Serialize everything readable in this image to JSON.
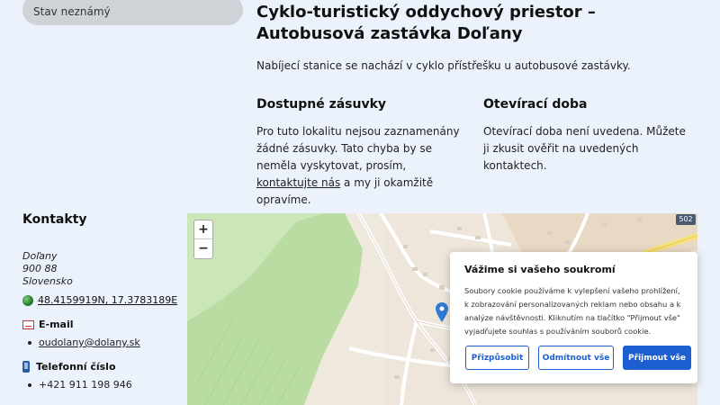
{
  "status": {
    "label": "Stav neznámý"
  },
  "station": {
    "title": "Cyklo-turistický oddychový priestor – Autobusová zastávka Doľany",
    "intro": "Nabíjecí stanice se nachází v cyklo přístřešku u autobusové zastávky."
  },
  "sockets": {
    "title": "Dostupné zásuvky",
    "text_before": "Pro tuto lokalitu nejsou zaznamenány žádné zásuvky. Tato chyba by se neměla vyskytovat, prosím, ",
    "link": "kontaktujte nás",
    "text_after": " a my ji okamžitě opravíme."
  },
  "hours": {
    "title": "Otevírací doba",
    "text": "Otevírací doba není uvedena. Můžete ji zkusit ověřit na uvedených kontaktech."
  },
  "contacts": {
    "title": "Kontakty",
    "address_line1": "Doľany",
    "address_line2": "900 88",
    "address_line3": "Slovensko",
    "coordinates": "48.4159919N, 17.3783189E",
    "email_label": "E-mail",
    "email": "oudolany@dolany.sk",
    "phone_label": "Telefonní číslo",
    "phone": "+421 911 198 946"
  },
  "map": {
    "zoom_in": "+",
    "zoom_out": "−",
    "road_number": "502"
  },
  "cookie": {
    "title": "Vážime si vašeho soukromí",
    "text": "Soubory cookie používáme k vylepšení vašeho prohlížení, k zobrazování personalizovaných reklam nebo obsahu a k analýze návštěvnosti. Kliknutím na tlačítko \"Přijmout vše\" vyjadřujete souhlas s používáním souborů cookie.",
    "customize": "Přizpůsobit",
    "reject": "Odmítnout vše",
    "accept": "Přijmout vše"
  }
}
